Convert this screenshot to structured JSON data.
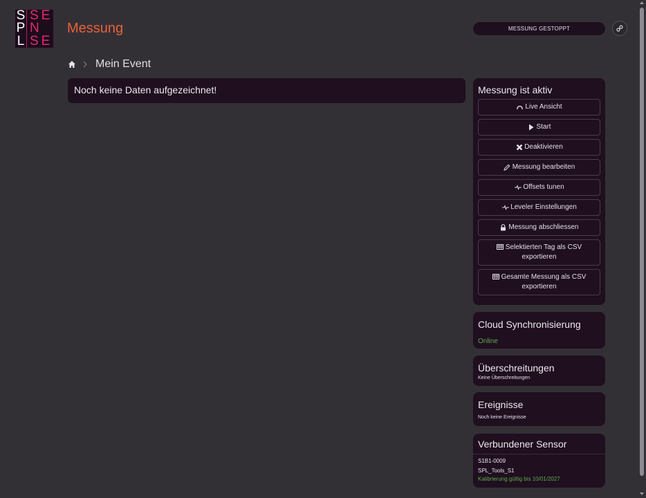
{
  "app": {
    "logo_left": [
      "S",
      "P",
      "L"
    ],
    "logo_right": [
      "SE",
      "N",
      "SE"
    ],
    "title": "Messung"
  },
  "header": {
    "status": "MESSUNG GESTOPPT",
    "settings_icon": "link-icon"
  },
  "breadcrumb": {
    "home_icon": "home-icon",
    "current": "Mein Event"
  },
  "main": {
    "empty_message": "Noch keine Daten aufgezeichnet!"
  },
  "measurement_panel": {
    "title": "Messung ist aktiv",
    "buttons": [
      {
        "icon": "gauge-icon",
        "label": "Live Ansicht"
      },
      {
        "icon": "play-icon",
        "label": "Start"
      },
      {
        "icon": "x-icon",
        "label": "Deaktivieren"
      },
      {
        "icon": "pencil-icon",
        "label": "Messung bearbeiten"
      },
      {
        "icon": "wave-icon",
        "label": "Offsets tunen"
      },
      {
        "icon": "wave-icon",
        "label": "Leveler Einstellungen"
      },
      {
        "icon": "lock-icon",
        "label": "Messung abschliessen"
      },
      {
        "icon": "table-icon",
        "label": "Selektierten Tag als CSV exportieren"
      },
      {
        "icon": "table-icon",
        "label": "Gesamte Messung als CSV exportieren"
      }
    ]
  },
  "cloud": {
    "title": "Cloud Synchronisierung",
    "status": "Online",
    "status_color": "#5fa84d"
  },
  "exceedances": {
    "title": "Überschreitungen",
    "text": "Keine Überschreitungen"
  },
  "events": {
    "title": "Ereignisse",
    "text": "Noch keine Ereignisse"
  },
  "sensor": {
    "title": "Verbundener Sensor",
    "id": "S1B1-0009",
    "name": "SPL_Tools_S1",
    "calibration": "Kalibrierung gültig bis 10/01/2027"
  },
  "colors": {
    "background": "#333035",
    "card": "#1f0f1f",
    "accent_title": "#e8613a",
    "logo_accent": "#e8286e",
    "success": "#5fa84d"
  }
}
